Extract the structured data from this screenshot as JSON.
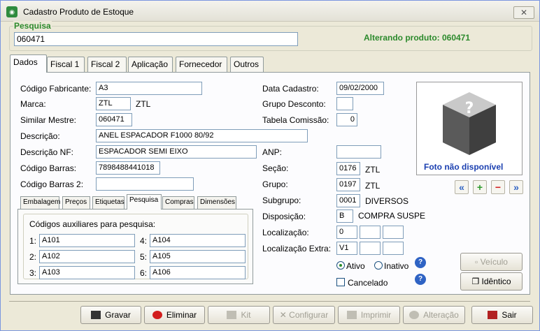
{
  "window": {
    "title": "Cadastro Produto de Estoque",
    "close_glyph": "✕"
  },
  "search": {
    "legend": "Pesquisa",
    "value": "060471",
    "status": "Alterando produto: 060471"
  },
  "tabs": [
    "Dados",
    "Fiscal 1",
    "Fiscal 2",
    "Aplicação",
    "Fornecedor",
    "Outros"
  ],
  "form": {
    "codigo_fabricante": {
      "label": "Código Fabricante:",
      "value": "A3"
    },
    "marca": {
      "label": "Marca:",
      "value": "ZTL",
      "desc": "ZTL"
    },
    "similar_mestre": {
      "label": "Similar Mestre:",
      "value": "060471"
    },
    "descricao": {
      "label": "Descrição:",
      "value": "ANEL ESPACADOR F1000 80/92"
    },
    "descricao_nf": {
      "label": "Descrição NF:",
      "value": "ESPACADOR SEMI EIXO"
    },
    "codigo_barras": {
      "label": "Código Barras:",
      "value": "7898488441018"
    },
    "codigo_barras2": {
      "label": "Código Barras 2:",
      "value": ""
    },
    "data_cadastro": {
      "label": "Data Cadastro:",
      "value": "09/02/2000"
    },
    "grupo_desconto": {
      "label": "Grupo Desconto:",
      "value": ""
    },
    "tabela_comissao": {
      "label": "Tabela Comissão:",
      "value": "0"
    },
    "anp": {
      "label": "ANP:",
      "value": ""
    },
    "secao": {
      "label": "Seção:",
      "value": "0176",
      "desc": "ZTL"
    },
    "grupo": {
      "label": "Grupo:",
      "value": "0197",
      "desc": "ZTL"
    },
    "subgrupo": {
      "label": "Subgrupo:",
      "value": "0001",
      "desc": "DIVERSOS"
    },
    "disposicao": {
      "label": "Disposição:",
      "value": "B",
      "desc": "COMPRA SUSPE"
    },
    "localizacao": {
      "label": "Localização:",
      "values": [
        "0",
        "",
        ""
      ]
    },
    "localizacao_extra": {
      "label": "Localização Extra:",
      "values": [
        "V1",
        "",
        ""
      ]
    },
    "status": {
      "ativo": "Ativo",
      "inativo": "Inativo",
      "cancelado": "Cancelado"
    }
  },
  "subtabs": [
    "Embalagem",
    "Preços",
    "Etiquetas",
    "Pesquisa",
    "Compras",
    "Dimensões"
  ],
  "aux": {
    "title": "Códigos auxiliares para pesquisa:",
    "items": [
      {
        "n": "1:",
        "value": "A101"
      },
      {
        "n": "4:",
        "value": "A104"
      },
      {
        "n": "2:",
        "value": "A102"
      },
      {
        "n": "5:",
        "value": "A105"
      },
      {
        "n": "3:",
        "value": "A103"
      },
      {
        "n": "6:",
        "value": "A106"
      }
    ]
  },
  "photo": {
    "caption": "Foto não disponível",
    "glyph": "?"
  },
  "nav": {
    "first": "«",
    "add": "+",
    "remove": "−",
    "last": "»"
  },
  "side_buttons": {
    "veiculo": "Veículo",
    "identico": "Idêntico"
  },
  "buttons": {
    "gravar": "Gravar",
    "eliminar": "Eliminar",
    "kit": "Kit",
    "configurar": "Configurar",
    "imprimir": "Imprimir",
    "alteracao": "Alteração",
    "sair": "Sair"
  },
  "colors": {
    "accent_green": "#2c8a2c",
    "photo_caption": "#1a3fb0"
  }
}
